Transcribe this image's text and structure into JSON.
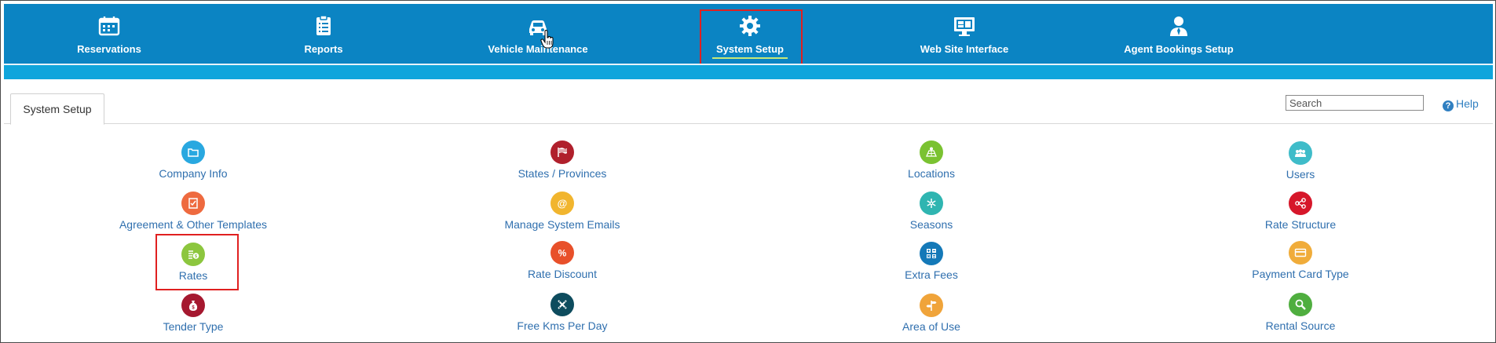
{
  "nav": {
    "items": [
      {
        "label": "Reservations",
        "icon": "calendar-icon"
      },
      {
        "label": "Reports",
        "icon": "clipboard-icon"
      },
      {
        "label": "Vehicle Maintenance",
        "icon": "car-icon"
      },
      {
        "label": "System Setup",
        "icon": "gear-icon",
        "active": true
      },
      {
        "label": "Web Site Interface",
        "icon": "monitor-icon"
      },
      {
        "label": "Agent Bookings Setup",
        "icon": "agent-icon"
      }
    ]
  },
  "tabs": [
    {
      "label": "System Setup"
    }
  ],
  "search": {
    "placeholder": "Search",
    "value": ""
  },
  "help": {
    "label": "Help"
  },
  "grid": {
    "columns": [
      [
        {
          "label": "Company Info",
          "icon": "folder-icon",
          "color": "#29a8e0"
        },
        {
          "label": "Agreement & Other Templates",
          "icon": "template-icon",
          "color": "#ee6a3f"
        },
        {
          "label": "Rates",
          "icon": "rates-icon",
          "color": "#8cc63e",
          "highlighted": true
        },
        {
          "label": "Tender Type",
          "icon": "money-bag-icon",
          "color": "#a5182f"
        }
      ],
      [
        {
          "label": "States / Provinces",
          "icon": "flag-icon",
          "color": "#b0202c"
        },
        {
          "label": "Manage System Emails",
          "icon": "at-icon",
          "color": "#f1b52e"
        },
        {
          "label": "Rate Discount",
          "icon": "percent-icon",
          "color": "#e8502a"
        },
        {
          "label": "Free Kms Per Day",
          "icon": "road-icon",
          "color": "#0e4c5e"
        }
      ],
      [
        {
          "label": "Locations",
          "icon": "map-icon",
          "color": "#7ac231"
        },
        {
          "label": "Seasons",
          "icon": "snowflake-icon",
          "color": "#2fb5b1"
        },
        {
          "label": "Extra Fees",
          "icon": "calculator-icon",
          "color": "#1479b8"
        },
        {
          "label": "Area of Use",
          "icon": "signpost-icon",
          "color": "#f0a43a"
        }
      ],
      [
        {
          "label": "Users",
          "icon": "users-icon",
          "color": "#3fbcc9"
        },
        {
          "label": "Rate Structure",
          "icon": "share-nodes-icon",
          "color": "#d6172a"
        },
        {
          "label": "Payment Card Type",
          "icon": "card-icon",
          "color": "#f0ac3a"
        },
        {
          "label": "Rental Source",
          "icon": "magnifier-icon",
          "color": "#4fae3f"
        }
      ]
    ]
  },
  "colors": {
    "nav_bg": "#0b84c3",
    "sub_bar": "#0fa5dc",
    "link": "#2f6fae",
    "highlight": "#e02020",
    "active_underline": "#c7e87a"
  }
}
